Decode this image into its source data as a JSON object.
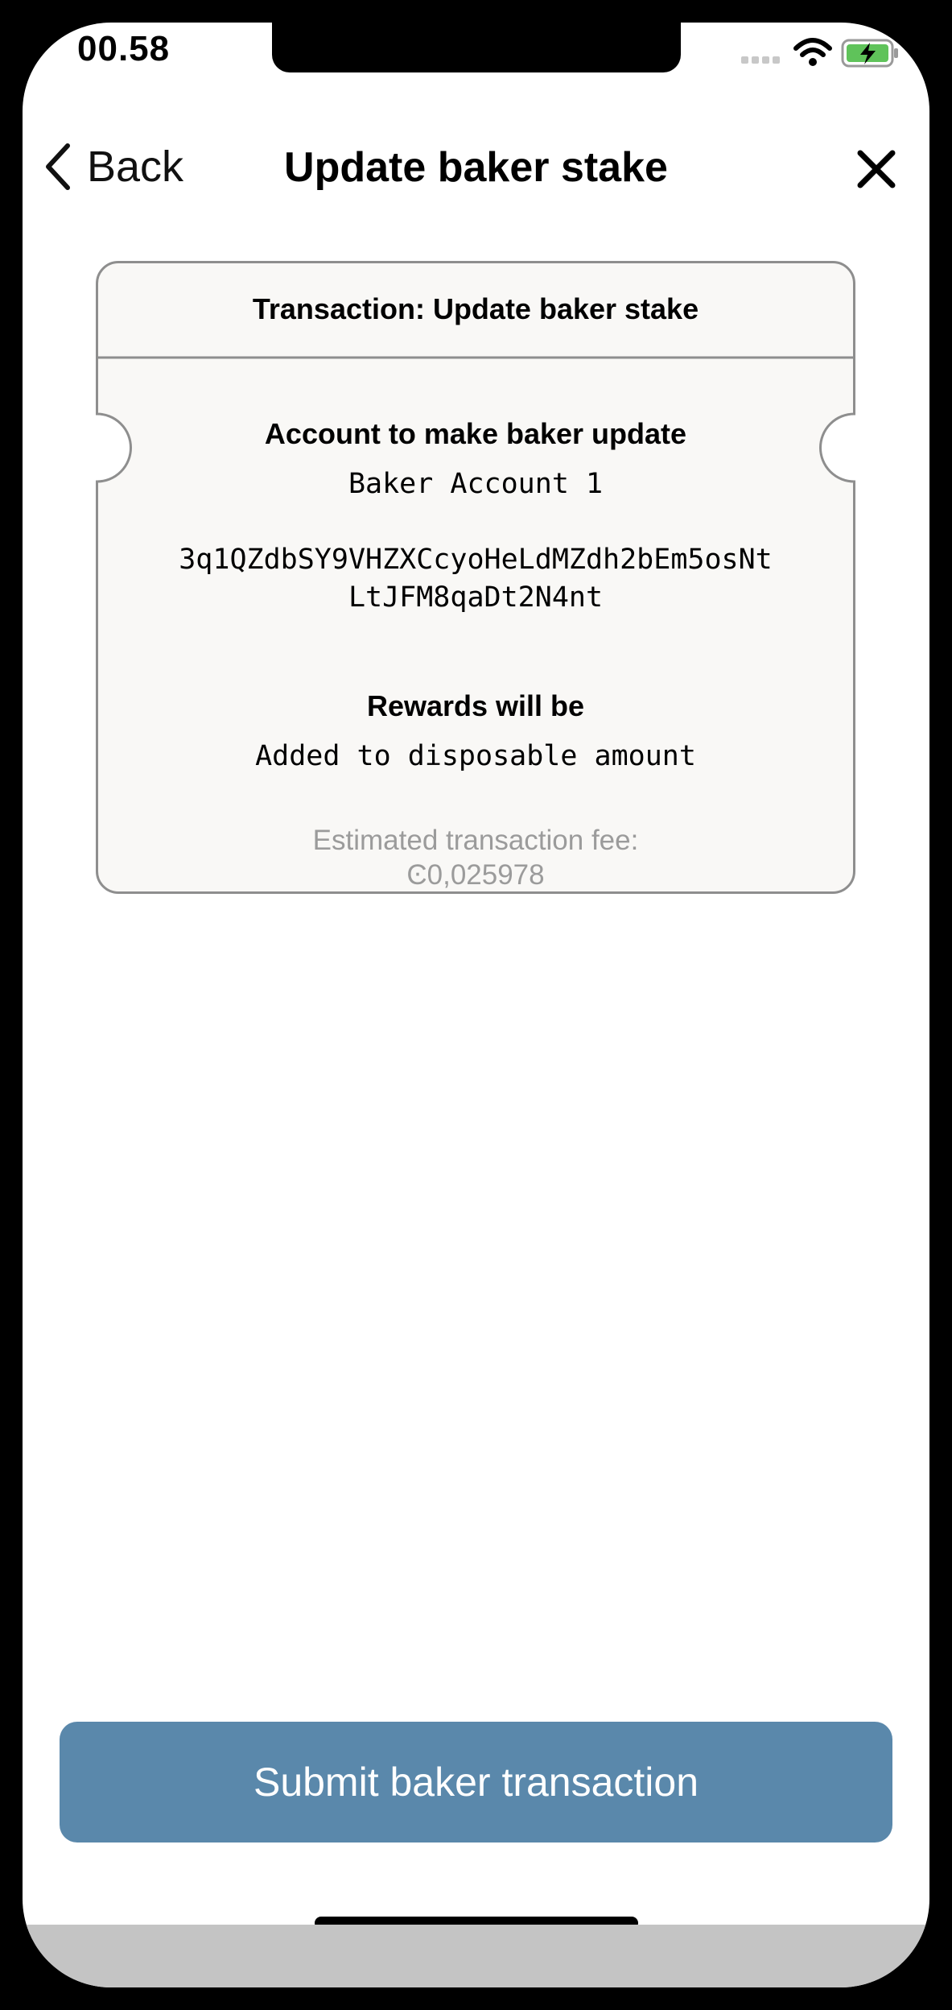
{
  "status_bar": {
    "time": "00.58",
    "icons": [
      "signal-icon",
      "wifi-icon",
      "battery-charging-icon"
    ]
  },
  "nav": {
    "back_label": "Back",
    "title": "Update baker stake",
    "close_icon": "close-icon"
  },
  "ticket": {
    "header": "Transaction: Update baker stake",
    "account_label": "Account to make baker update",
    "account_name": "Baker Account 1",
    "address_line1": "3q1QZdbSY9VHZXCcyoHeLdMZdh2bEm5osNt",
    "address_line2": "LtJFM8qaDt2N4nt",
    "rewards_label": "Rewards will be",
    "rewards_value": "Added to disposable amount",
    "fee_label": "Estimated transaction fee:",
    "fee_value": "Ͼ0,025978"
  },
  "submit_label": "Submit baker transaction",
  "colors": {
    "accent": "#5a88ab",
    "ticket_background": "#f9f8f6",
    "ticket_border": "#8e8e8e",
    "fee_text": "#9b9b9b"
  }
}
